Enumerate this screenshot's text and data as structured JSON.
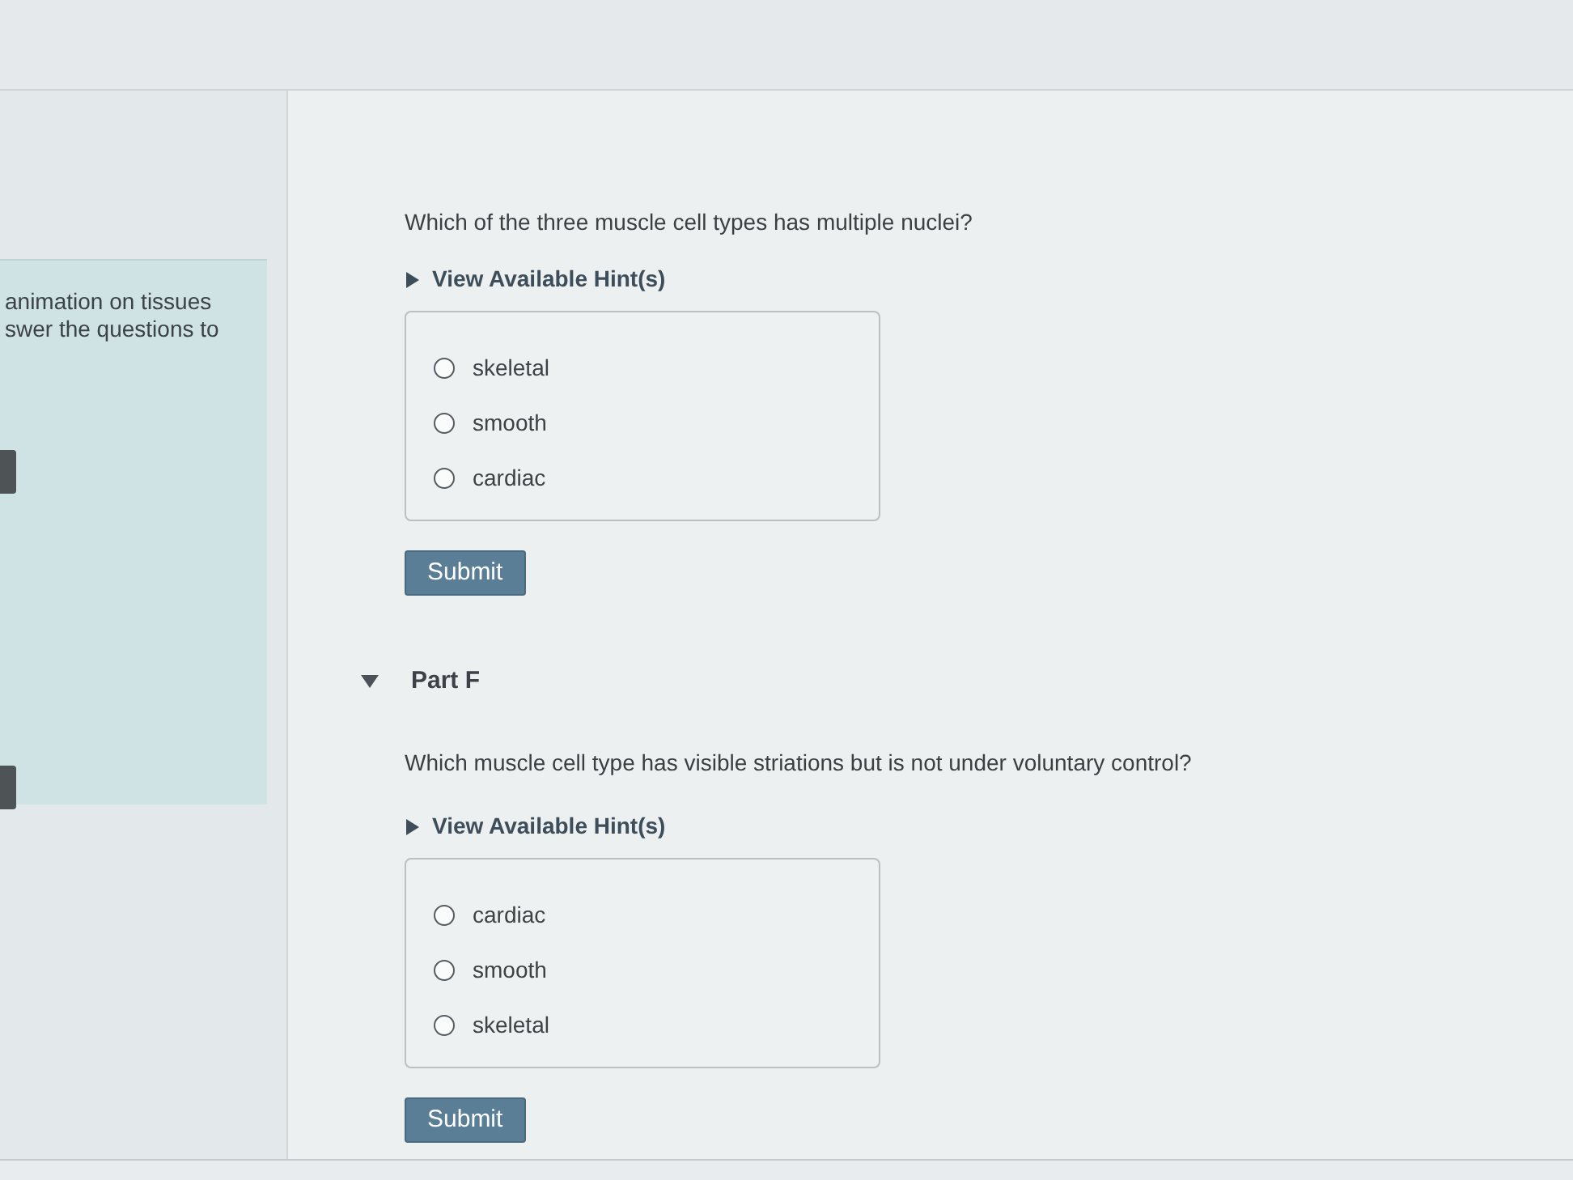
{
  "sidebar": {
    "intro_lines": [
      "animation on tissues",
      "swer the questions to"
    ]
  },
  "parts": [
    {
      "question": "Which of the three muscle cell types has multiple nuclei?",
      "hint": {
        "label": "View Available Hint(s)",
        "expanded": false
      },
      "options": [
        {
          "label": "skeletal",
          "selected": false
        },
        {
          "label": "smooth",
          "selected": false
        },
        {
          "label": "cardiac",
          "selected": false
        }
      ],
      "submit": "Submit"
    },
    {
      "title": "Part F",
      "expanded": true,
      "question": "Which muscle cell type has visible striations but is not under voluntary control?",
      "hint": {
        "label": "View Available Hint(s)",
        "expanded": false
      },
      "options": [
        {
          "label": "cardiac",
          "selected": false
        },
        {
          "label": "smooth",
          "selected": false
        },
        {
          "label": "skeletal",
          "selected": false
        }
      ],
      "submit": "Submit"
    }
  ]
}
